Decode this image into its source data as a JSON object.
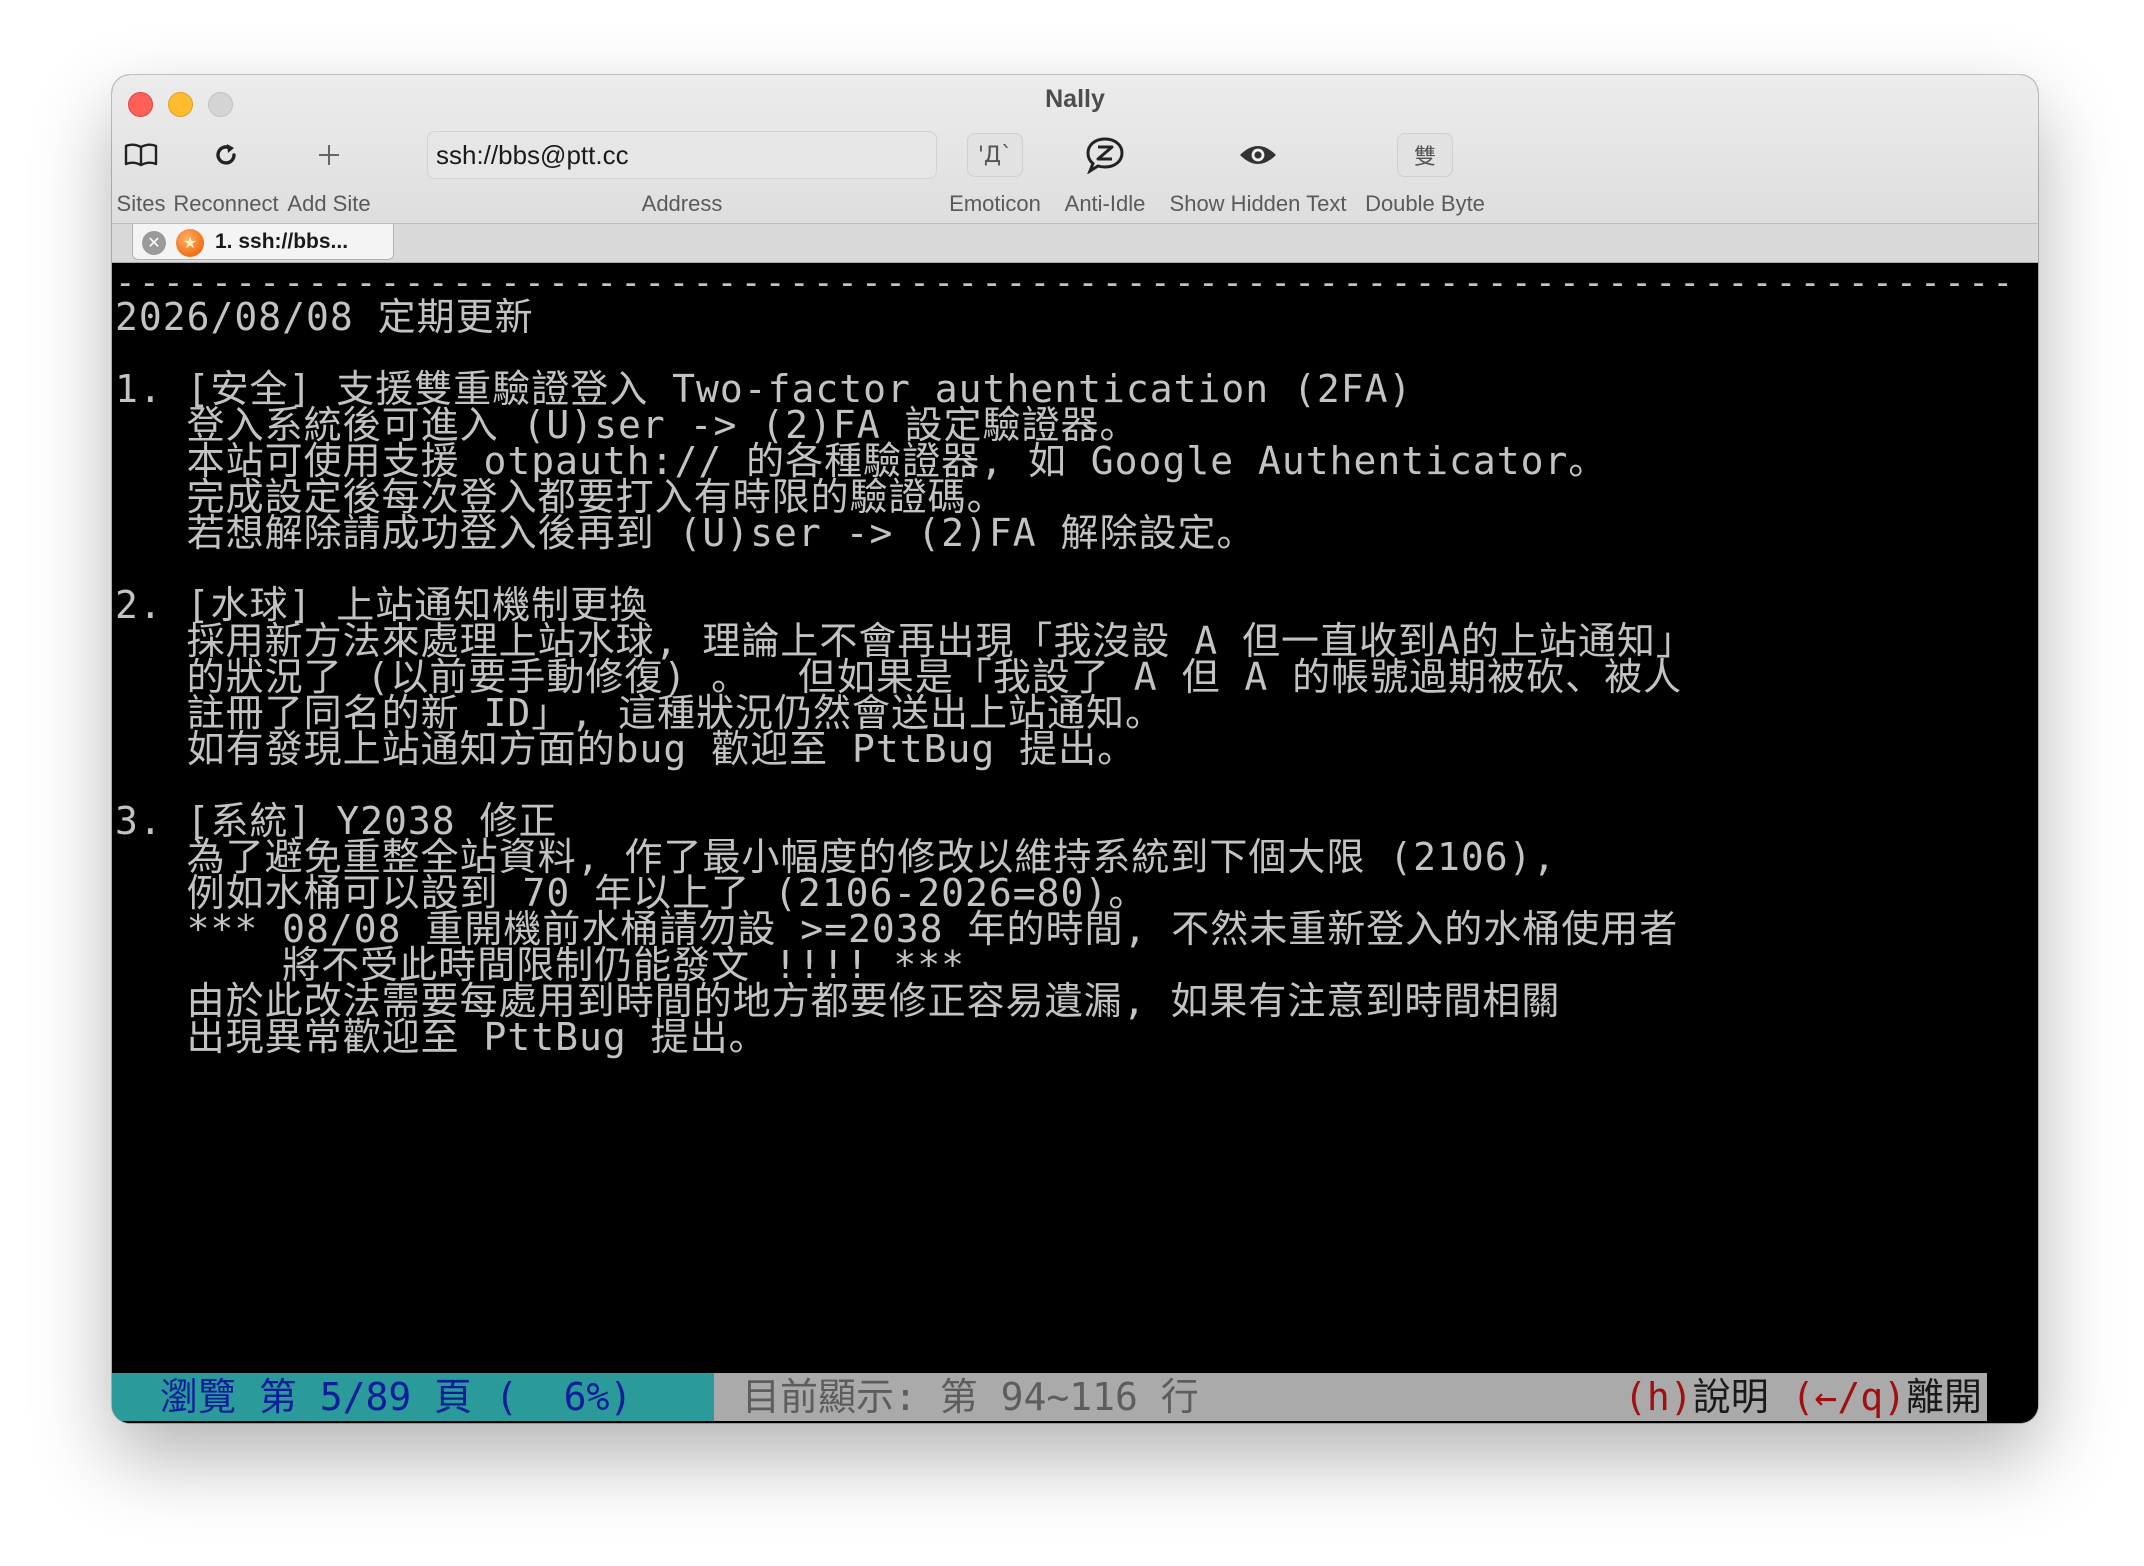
{
  "window": {
    "title": "Nally"
  },
  "toolbar": {
    "sites": {
      "label": "Sites",
      "icon": "book-icon"
    },
    "reconnect": {
      "label": "Reconnect",
      "icon": "reload-icon"
    },
    "add_site": {
      "label": "Add Site",
      "icon": "plus-icon"
    },
    "address": {
      "value": "ssh://bbs@ptt.cc",
      "label": "Address"
    },
    "emoticon": {
      "label": "Emoticon",
      "glyph": "'Д`"
    },
    "anti_idle": {
      "label": "Anti-Idle",
      "icon": "speech-bubble-z-icon"
    },
    "show_hidden_text": {
      "label": "Show Hidden Text",
      "icon": "eye-icon"
    },
    "double_byte": {
      "label": "Double Byte",
      "glyph": "雙"
    }
  },
  "tabs": [
    {
      "title": "1. ssh://bbs...",
      "close_glyph": "✕",
      "status_icon": "orange-star-icon"
    }
  ],
  "terminal": {
    "separator": "-------------------------------------------------------------------------------",
    "lines": [
      "2026/08/08 定期更新",
      "1. [安全] 支援雙重驗證登入 Two-factor authentication (2FA)",
      "   登入系統後可進入 (U)ser -> (2)FA 設定驗證器。",
      "   本站可使用支援 otpauth:// 的各種驗證器, 如 Google Authenticator。",
      "   完成設定後每次登入都要打入有時限的驗證碼。",
      "   若想解除請成功登入後再到 (U)ser -> (2)FA 解除設定。",
      "2. [水球] 上站通知機制更換",
      "   採用新方法來處理上站水球, 理論上不會再出現「我沒設 A 但一直收到A的上站通知」",
      "   的狀況了 (以前要手動修復) 。  但如果是「我設了 A 但 A 的帳號過期被砍、被人",
      "   註冊了同名的新 ID」, 這種狀況仍然會送出上站通知。",
      "   如有發現上站通知方面的bug 歡迎至 PttBug 提出。",
      "3. [系統] Y2038 修正",
      "   為了避免重整全站資料, 作了最小幅度的修改以維持系統到下個大限 (2106),",
      "   例如水桶可以設到 70 年以上了 (2106-2026=80)。",
      "   *** 08/08 重開機前水桶請勿設 >=2038 年的時間, 不然未重新登入的水桶使用者",
      "       將不受此時間限制仍能發文 !!!! ***",
      "   由於此改法需要每處用到時間的地方都要修正容易遺漏, 如果有注意到時間相關",
      "   出現異常歡迎至 PttBug 提出。"
    ]
  },
  "statusbar": {
    "browse": "瀏覽 第 5/89 頁 (  6%)",
    "showing": "目前顯示: 第 94~116 行",
    "help_key": "(h)",
    "help_label": "說明",
    "leave_key": "(←/q)",
    "leave_label": "離開"
  },
  "colors": {
    "terminal_bg": "#000000",
    "terminal_fg": "#c3c3c3",
    "status_left_bg": "#2a9a9a",
    "status_left_fg": "#0a1e9a",
    "status_bg": "#aaaaaa",
    "status_key": "#a01010"
  }
}
